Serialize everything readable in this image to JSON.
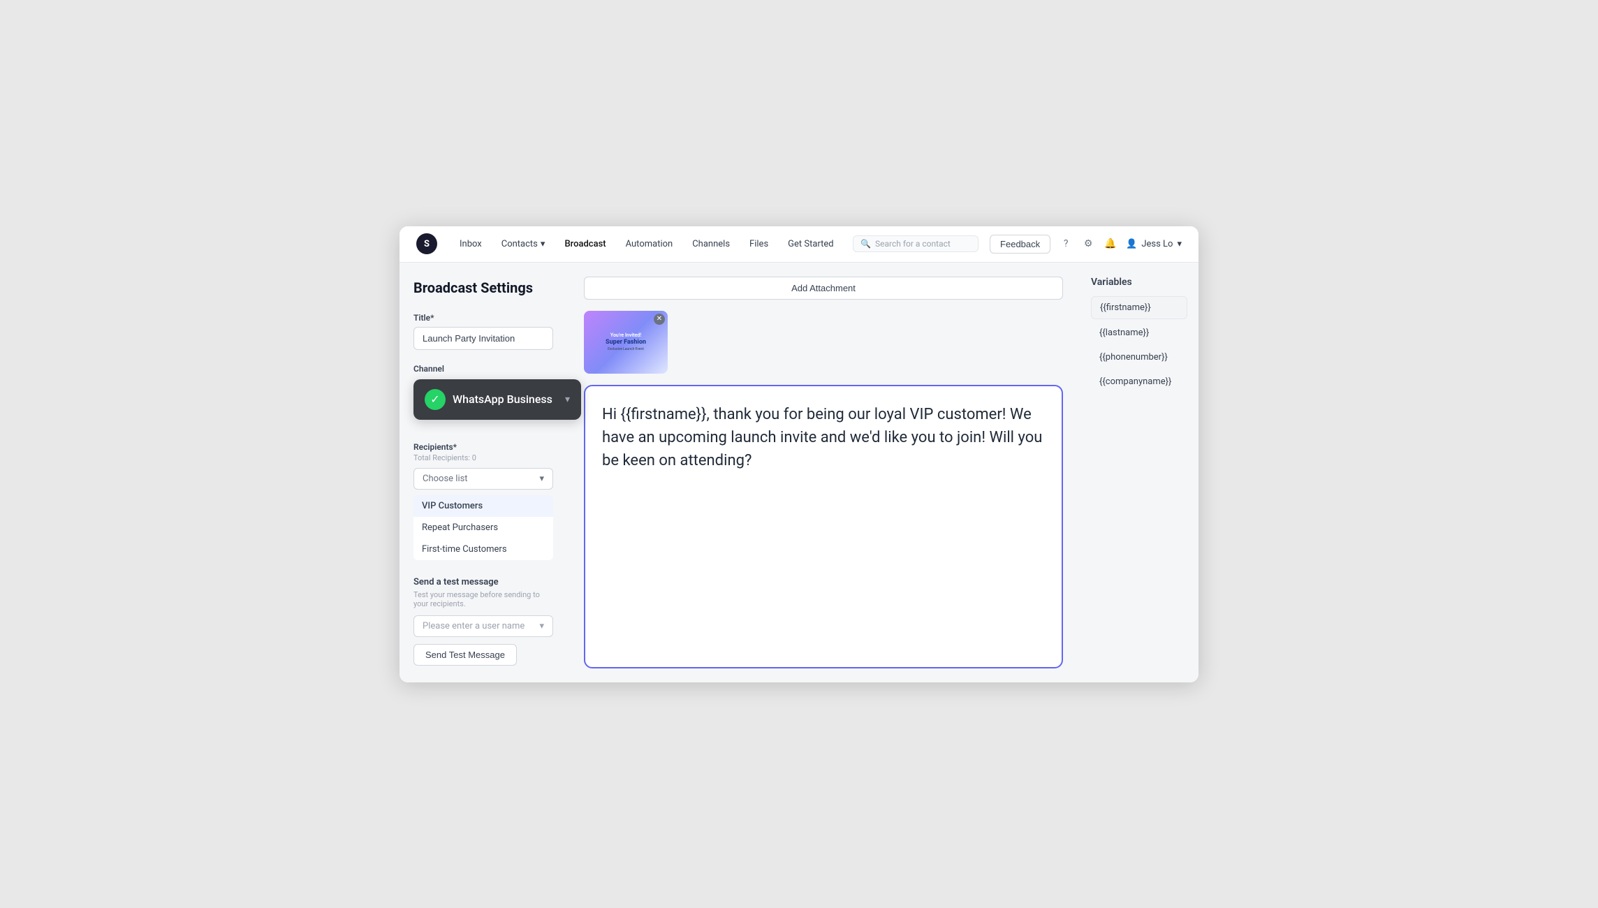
{
  "nav": {
    "logo_letter": "S",
    "items": [
      {
        "label": "Inbox",
        "active": false
      },
      {
        "label": "Contacts",
        "active": false,
        "has_arrow": true
      },
      {
        "label": "Broadcast",
        "active": true
      },
      {
        "label": "Automation",
        "active": false
      },
      {
        "label": "Channels",
        "active": false
      },
      {
        "label": "Files",
        "active": false
      },
      {
        "label": "Get Started",
        "active": false
      }
    ],
    "search_placeholder": "Search for a contact",
    "feedback_label": "Feedback",
    "user_name": "Jess Lo"
  },
  "page": {
    "title": "Broadcast Settings"
  },
  "form": {
    "title_label": "Title*",
    "title_value": "Launch Party Invitation",
    "channel_label": "Channel",
    "channel_name": "WhatsApp Business",
    "recipients_label": "Recipients*",
    "total_recipients": "Total Recipients: 0",
    "choose_list_placeholder": "Choose list",
    "list_options": [
      {
        "label": "VIP Customers",
        "selected": true
      },
      {
        "label": "Repeat Purchasers",
        "selected": false
      },
      {
        "label": "First-time Customers",
        "selected": false
      }
    ],
    "send_test_title": "Send a test message",
    "send_test_desc": "Test your message before sending to your recipients.",
    "user_placeholder": "Please enter a user name",
    "send_test_btn": "Send Test Message",
    "add_attachment_label": "Add Attachment"
  },
  "attachment": {
    "invited_text": "You're Invited!",
    "brand_name": "Super Fashion",
    "event_label": "Exclusive Launch Event"
  },
  "message": {
    "content": "Hi {{firstname}}, thank you for being our loyal VIP customer! We have an upcoming launch invite and we'd like you to join! Will you be keen on attending?"
  },
  "variables": {
    "title": "Variables",
    "items": [
      {
        "label": "{{firstname}}",
        "selected": true
      },
      {
        "label": "{{lastname}}",
        "selected": false
      },
      {
        "label": "{{phonenumber}}",
        "selected": false
      },
      {
        "label": "{{companyname}}",
        "selected": false
      }
    ]
  }
}
